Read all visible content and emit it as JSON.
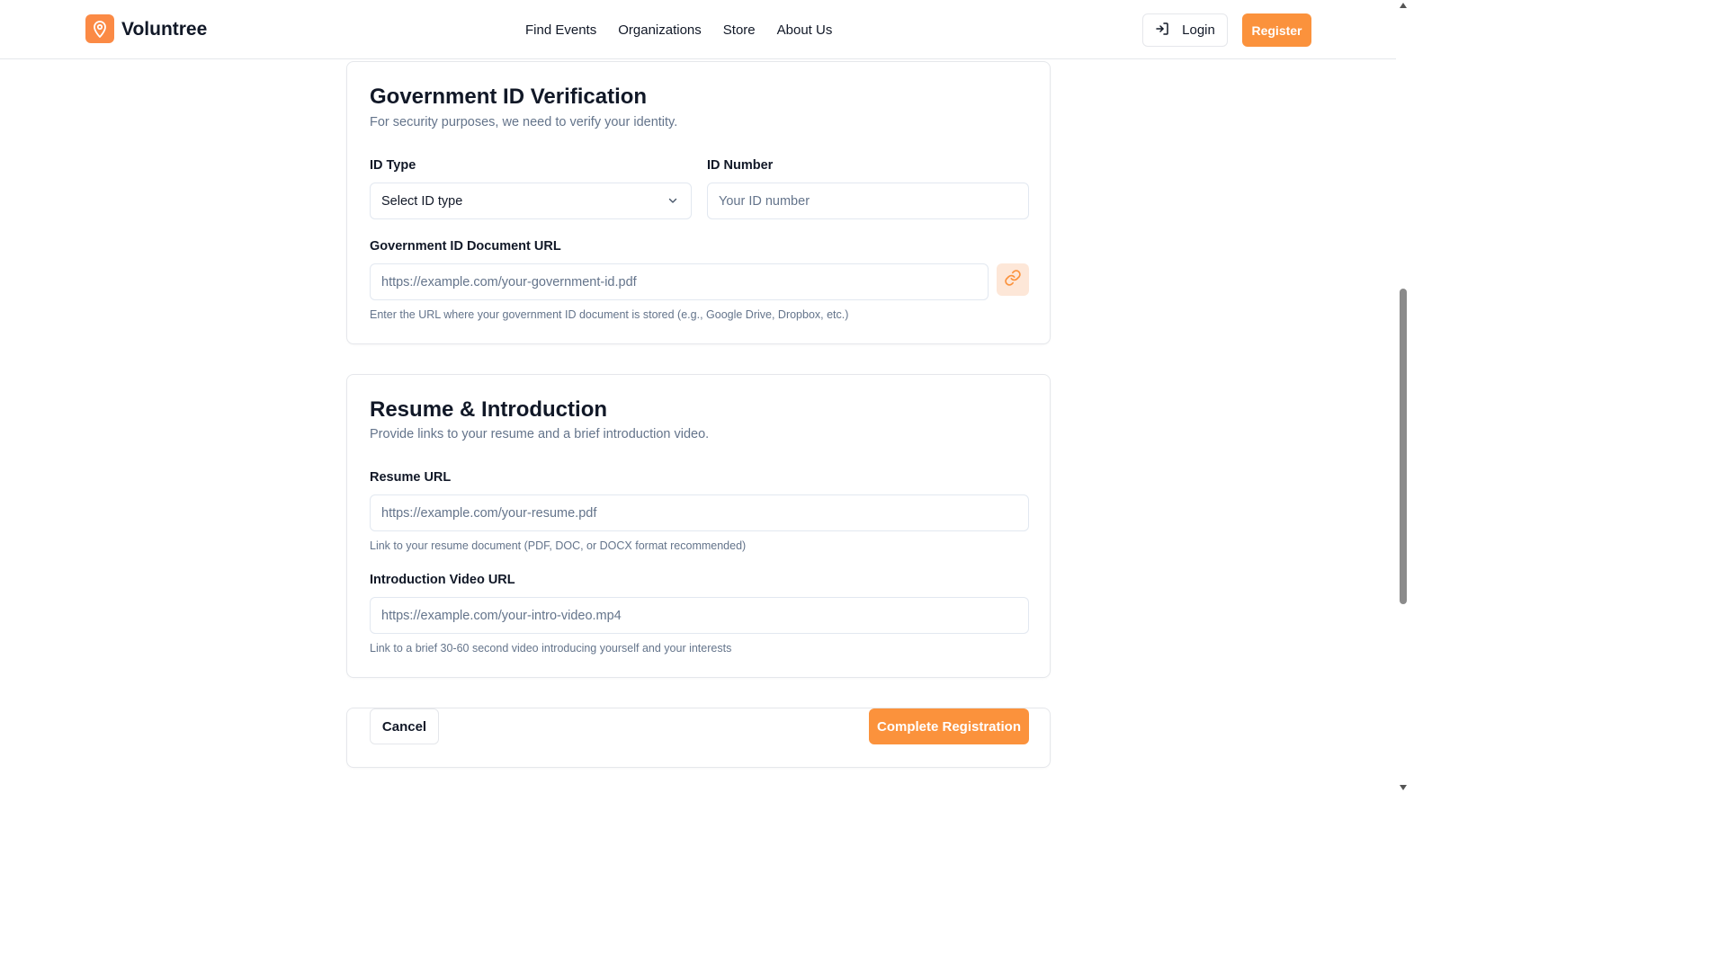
{
  "brand": {
    "name": "Voluntree",
    "accent": "#fb923c"
  },
  "nav": {
    "items": [
      {
        "label": "Find Events"
      },
      {
        "label": "Organizations"
      },
      {
        "label": "Store"
      },
      {
        "label": "About Us"
      }
    ],
    "login_label": "Login",
    "register_label": "Register"
  },
  "gov_id": {
    "title": "Government ID Verification",
    "subtitle": "For security purposes, we need to verify your identity.",
    "id_type_label": "ID Type",
    "id_type_value": "Select ID type",
    "id_number_label": "ID Number",
    "id_number_placeholder": "Your ID number",
    "doc_url_label": "Government ID Document URL",
    "doc_url_placeholder": "https://example.com/your-government-id.pdf",
    "doc_url_hint": "Enter the URL where your government ID document is stored (e.g., Google Drive, Dropbox, etc.)"
  },
  "resume": {
    "title": "Resume & Introduction",
    "subtitle": "Provide links to your resume and a brief introduction video.",
    "resume_label": "Resume URL",
    "resume_placeholder": "https://example.com/your-resume.pdf",
    "resume_hint": "Link to your resume document (PDF, DOC, or DOCX format recommended)",
    "video_label": "Introduction Video URL",
    "video_placeholder": "https://example.com/your-intro-video.mp4",
    "video_hint": "Link to a brief 30-60 second video introducing yourself and your interests"
  },
  "actions": {
    "cancel_label": "Cancel",
    "complete_label": "Complete Registration"
  }
}
